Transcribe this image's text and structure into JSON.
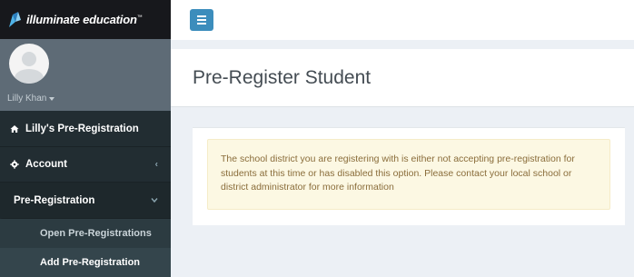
{
  "brand": {
    "name": "illuminate education",
    "trademark": "™"
  },
  "user": {
    "name": "Lilly Khan"
  },
  "sidebar": {
    "items": [
      {
        "label": "Lilly's Pre-Registration",
        "icon": "home-icon"
      },
      {
        "label": "Account",
        "icon": "gear-icon",
        "arrow": "‹"
      },
      {
        "label": "Pre-Registration",
        "icon": "",
        "arrow": "⌄"
      }
    ],
    "submenu": [
      {
        "label": "Open Pre-Registrations",
        "active": false
      },
      {
        "label": "Add Pre-Registration",
        "active": true
      }
    ]
  },
  "page": {
    "title": "Pre-Register Student"
  },
  "alert": {
    "message": "The school district you are registering with is either not accepting pre-registration for students at this time or has disabled this option. Please contact your local school or district administrator for more information"
  },
  "colors": {
    "sidebar_bg": "#222d32",
    "accent": "#3c8dbc",
    "alert_bg": "#fcf8e3",
    "alert_text": "#8a6d3b"
  }
}
